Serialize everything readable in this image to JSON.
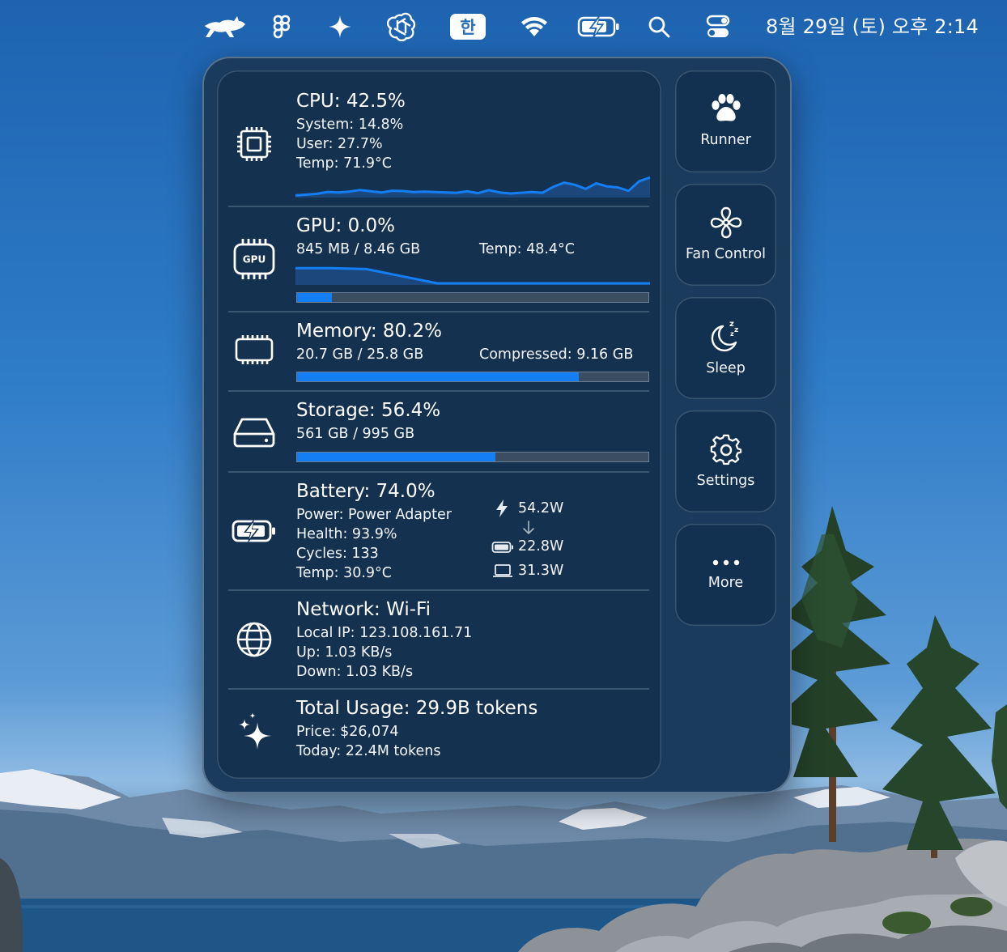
{
  "menubar": {
    "icons": [
      "runcat-icon",
      "figma-icon",
      "sparkle-icon",
      "chatgpt-icon",
      "input-source-icon",
      "wifi-icon",
      "battery-charging-icon",
      "search-icon",
      "control-center-icon"
    ],
    "input_source": "한",
    "clock": "8월 29일 (토) 오후 2:14"
  },
  "cpu": {
    "title": "CPU: 42.5%",
    "system": "System: 14.8%",
    "user": "User: 27.7%",
    "temp": "Temp: 71.9°C",
    "history": [
      0.5,
      1.2,
      2.0,
      3.8,
      3.2,
      4.1,
      5.6,
      4.4,
      3.2,
      4.9,
      4.6,
      3.6,
      4.0,
      3.6,
      3.3,
      3.0,
      4.3,
      2.6,
      5.5,
      3.3,
      2.3,
      3.0,
      3.6,
      3.0,
      8.6,
      12.6,
      10.6,
      6.6,
      12.0,
      9.0,
      8.1,
      4.8,
      14.0,
      17.5
    ],
    "history_max": 20
  },
  "gpu": {
    "title": "GPU: 0.0%",
    "memory": "845 MB / 8.46 GB",
    "temp": "Temp: 48.4°C",
    "history": [
      17,
      17,
      16,
      8,
      0,
      0,
      0,
      0,
      0,
      0,
      0
    ],
    "history_max": 20,
    "memory_fraction": 0.1
  },
  "memory": {
    "title": "Memory: 80.2%",
    "used": "20.7 GB / 25.8 GB",
    "compressed": "Compressed: 9.16 GB",
    "fraction": 0.802
  },
  "storage": {
    "title": "Storage: 56.4%",
    "used": "561 GB / 995 GB",
    "fraction": 0.564
  },
  "battery": {
    "title": "Battery: 74.0%",
    "power": "Power: Power Adapter",
    "health": "Health: 93.9%",
    "cycles": "Cycles: 133",
    "temp": "Temp: 30.9°C",
    "adapter_watts": "54.2W",
    "battery_watts": "22.8W",
    "system_watts": "31.3W"
  },
  "network": {
    "title": "Network: Wi-Fi",
    "local_ip": "Local IP: 123.108.161.71",
    "up": "Up: 1.03 KB/s",
    "down": "Down: 1.03 KB/s"
  },
  "usage": {
    "title": "Total Usage: 29.9B tokens",
    "price": "Price: $26,074",
    "today": "Today: 22.4M tokens"
  },
  "side": {
    "runner": "Runner",
    "fan": "Fan Control",
    "sleep": "Sleep",
    "settings": "Settings",
    "more": "More"
  },
  "colors": {
    "accent": "#147ef5",
    "panel": "#1a3b5c",
    "card": "#143150"
  }
}
